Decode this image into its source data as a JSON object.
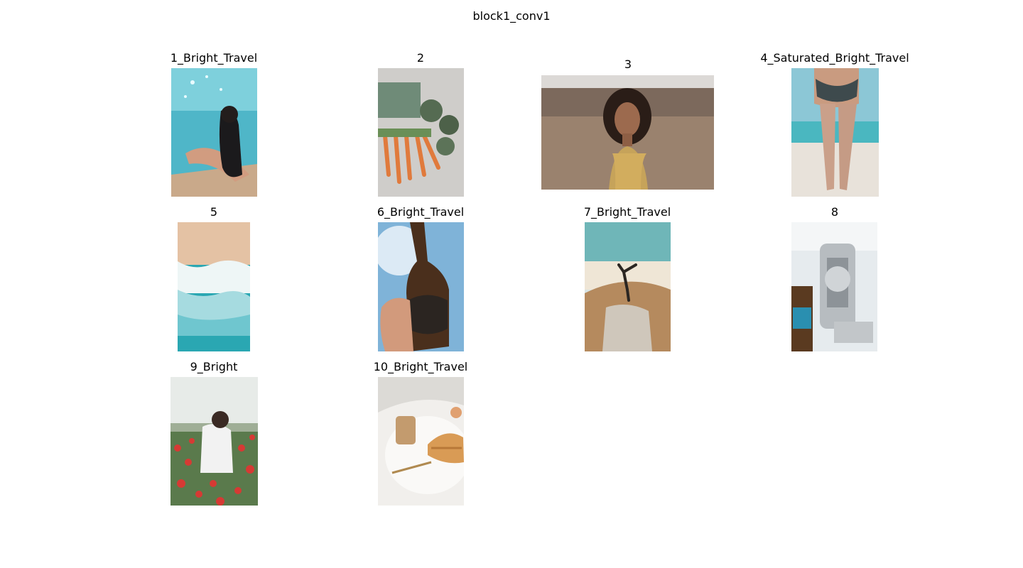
{
  "figure": {
    "title": "block1_conv1"
  },
  "panels": [
    {
      "title": "1_Bright_Travel",
      "image": "woman-in-pool-photo"
    },
    {
      "title": "2",
      "image": "carrots-and-artichokes-photo"
    },
    {
      "title": "3",
      "image": "woman-portrait-desert-photo"
    },
    {
      "title": "4_Saturated_Bright_Travel",
      "image": "woman-on-beach-photo"
    },
    {
      "title": "5",
      "image": "aerial-beach-waves-photo"
    },
    {
      "title": "6_Bright_Travel",
      "image": "beer-bottle-805-photo"
    },
    {
      "title": "7_Bright_Travel",
      "image": "handstand-on-dunes-photo"
    },
    {
      "title": "8",
      "image": "espresso-machine-photo"
    },
    {
      "title": "9_Bright",
      "image": "woman-in-poppy-field-photo"
    },
    {
      "title": "10_Bright_Travel",
      "image": "croissant-breakfast-photo"
    }
  ]
}
